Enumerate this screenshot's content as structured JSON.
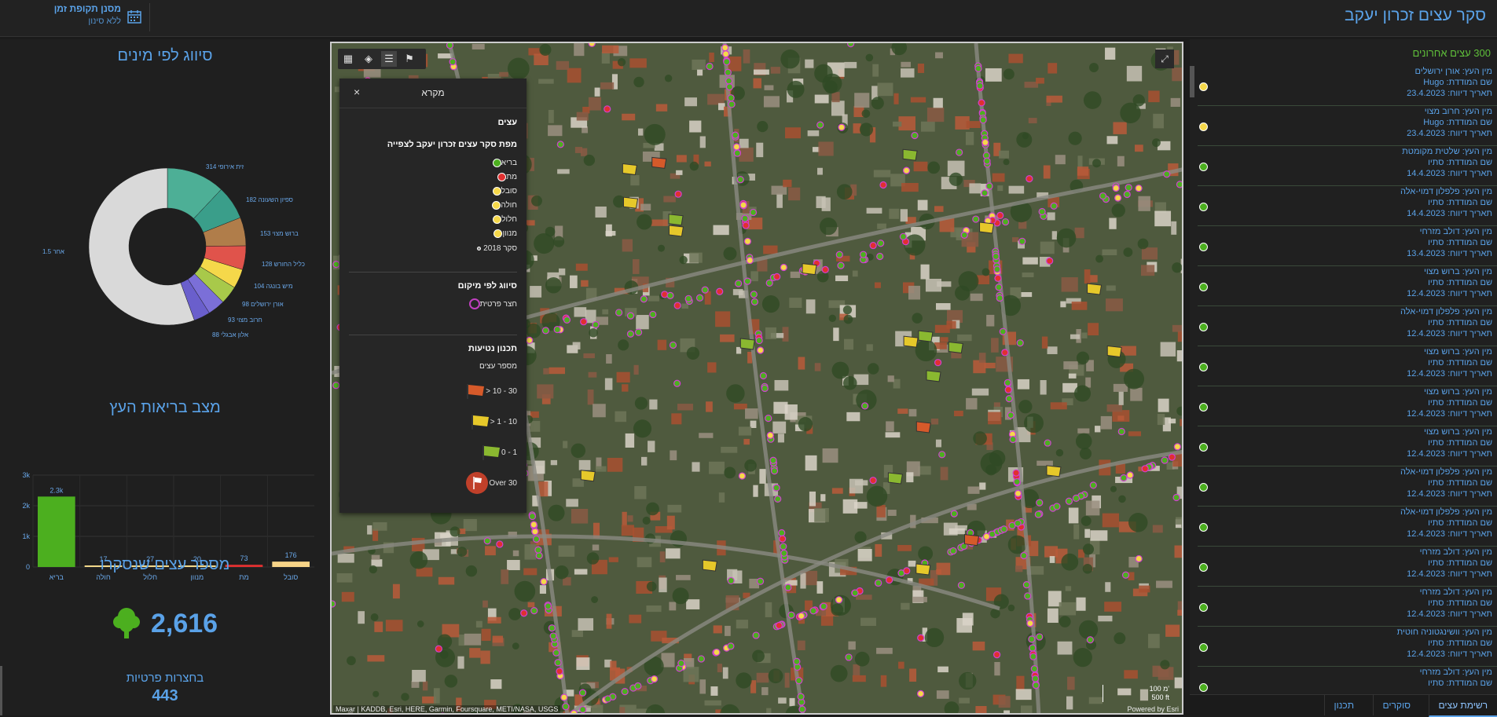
{
  "header": {
    "title": "סקר עצים זכרון יעקב",
    "filter_title": "מסנן תקופת זמן",
    "filter_subtitle": "ללא סינון"
  },
  "species_panel": {
    "title": "סיווג לפי מינים",
    "labels": [
      {
        "name": "זית אירופי",
        "value": "314"
      },
      {
        "name": "ספיון השעונה",
        "value": "182"
      },
      {
        "name": "ברוש מצוי",
        "value": "153"
      },
      {
        "name": "כליל החורש",
        "value": "128"
      },
      {
        "name": "מיש בונגה",
        "value": "104"
      },
      {
        "name": "אורן ירושלים",
        "value": "98"
      },
      {
        "name": "חרוב מצוי",
        "value": "93"
      },
      {
        "name": "אלון אבגלי",
        "value": "88"
      },
      {
        "name": "אחר",
        "value": "1.5"
      }
    ]
  },
  "health_panel": {
    "title": "מצב בריאות העץ"
  },
  "count_panel": {
    "title": "מספר עצים שנסקרו",
    "value": "2,616",
    "private_label": "בחצרות פרטיות",
    "private_value": "443"
  },
  "chart_data": [
    {
      "type": "pie",
      "title": "סיווג לפי מינים",
      "categories": [
        "זית אירופי",
        "ספיון השעונה",
        "ברוש מצוי",
        "כליל החורש",
        "מיש בונגה",
        "אורן ירושלים",
        "חרוב מצוי",
        "אלון אבגלי",
        "אחר"
      ],
      "values": [
        314,
        182,
        153,
        128,
        104,
        98,
        93,
        88,
        1452
      ],
      "colors": [
        "#4daf96",
        "#3a9e8a",
        "#b07d4a",
        "#e0534b",
        "#f5d84a",
        "#a8c94a",
        "#7b6fd8",
        "#6a5fcc",
        "#d9d9d9"
      ]
    },
    {
      "type": "bar",
      "title": "מצב בריאות העץ",
      "categories": [
        "בריא",
        "חולה",
        "חלול",
        "מנוון",
        "מת",
        "סובל"
      ],
      "values": [
        2300,
        17,
        27,
        20,
        73,
        176
      ],
      "data_labels": [
        "2.3k",
        "17",
        "27",
        "20",
        "73",
        "176"
      ],
      "colors": [
        "#4caf1f",
        "#f2d88a",
        "#f2d88a",
        "#f2d88a",
        "#e03030",
        "#f7d488"
      ],
      "ylim": [
        0,
        3000
      ],
      "yticks": [
        "0",
        "1k",
        "2k",
        "3k"
      ]
    }
  ],
  "legend": {
    "title": "מקרא",
    "section1": "עצים",
    "layer_title": "מפת סקר עצים זכרון יעקב לצפייה",
    "items": [
      {
        "label": "בריא",
        "color": "#4caf1f"
      },
      {
        "label": "מת",
        "color": "#e03030"
      },
      {
        "label": "סובל",
        "color": "#f5d84a"
      },
      {
        "label": "חולה",
        "color": "#f5d84a"
      },
      {
        "label": "חלול",
        "color": "#f5d84a"
      },
      {
        "label": "מנוון",
        "color": "#f5d84a"
      }
    ],
    "survey_2018": "סקר 2018",
    "location_title": "סיווג לפי מיקום",
    "private_yard": "חצר פרטית",
    "planting_title": "תכנון נטיעות",
    "planting_sub": "מספר עצים",
    "flags": [
      {
        "label": "30 - 10 <",
        "color": "#d65a2a"
      },
      {
        "label": "10 - 1 <",
        "color": "#e6c82a"
      },
      {
        "label": "1 - 0",
        "color": "#8ab830"
      },
      {
        "label": "Over 30",
        "color": "#c0402a"
      }
    ]
  },
  "map": {
    "attribution": "Maxar | KADDB, Esri, HERE, Garmin, Foursquare, METI/NASA, USGS",
    "powered": "Powered by Esri",
    "scale_metric": "100 מ'",
    "scale_imperial": "500 ft"
  },
  "recent": {
    "title": "300 עצים אחרונים",
    "items": [
      {
        "species": "מין העץ: אורן ירושלים",
        "surveyor": "שם המודדת: Hugo",
        "date": "תאריך דיווח: 23.4.2023",
        "dot": "#f5d84a"
      },
      {
        "species": "מין העץ: חרוב מצוי",
        "surveyor": "שם המודדת: Hugo",
        "date": "תאריך דיווח: 23.4.2023",
        "dot": "#f5d84a"
      },
      {
        "species": "מין העץ: שלטית מקומטת",
        "surveyor": "שם המודדת: סתיו",
        "date": "תאריך דיווח: 14.4.2023",
        "dot": "#4caf1f"
      },
      {
        "species": "מין העץ: פלפלון דמוי-אלה",
        "surveyor": "שם המודדת: סתיו",
        "date": "תאריך דיווח: 14.4.2023",
        "dot": "#4caf1f"
      },
      {
        "species": "מין העץ: דולב מזרחי",
        "surveyor": "שם המודדת: סתיו",
        "date": "תאריך דיווח: 13.4.2023",
        "dot": "#4caf1f"
      },
      {
        "species": "מין העץ: ברוש מצוי",
        "surveyor": "שם המודדת: סתיו",
        "date": "תאריך דיווח: 12.4.2023",
        "dot": "#4caf1f"
      },
      {
        "species": "מין העץ: פלפלון דמוי-אלה",
        "surveyor": "שם המודדת: סתיו",
        "date": "תאריך דיווח: 12.4.2023",
        "dot": "#4caf1f"
      },
      {
        "species": "מין העץ: ברוש מצוי",
        "surveyor": "שם המודדת: סתיו",
        "date": "תאריך דיווח: 12.4.2023",
        "dot": "#4caf1f"
      },
      {
        "species": "מין העץ: ברוש מצוי",
        "surveyor": "שם המודדת: סתיו",
        "date": "תאריך דיווח: 12.4.2023",
        "dot": "#4caf1f"
      },
      {
        "species": "מין העץ: ברוש מצוי",
        "surveyor": "שם המודדת: סתיו",
        "date": "תאריך דיווח: 12.4.2023",
        "dot": "#4caf1f"
      },
      {
        "species": "מין העץ: פלפלון דמוי-אלה",
        "surveyor": "שם המודדת: סתיו",
        "date": "תאריך דיווח: 12.4.2023",
        "dot": "#4caf1f"
      },
      {
        "species": "מין העץ: פלפלון דמוי-אלה",
        "surveyor": "שם המודדת: סתיו",
        "date": "תאריך דיווח: 12.4.2023",
        "dot": "#4caf1f"
      },
      {
        "species": "מין העץ: דולב מזרחי",
        "surveyor": "שם המודדת: סתיו",
        "date": "תאריך דיווח: 12.4.2023",
        "dot": "#4caf1f"
      },
      {
        "species": "מין העץ: דולב מזרחי",
        "surveyor": "שם המודדת: סתיו",
        "date": "תאריך דיווח: 12.4.2023",
        "dot": "#4caf1f"
      },
      {
        "species": "מין העץ: וושינגטוניה חוטית",
        "surveyor": "שם המודדת: סתיו",
        "date": "תאריך דיווח: 12.4.2023",
        "dot": "#4caf1f"
      },
      {
        "species": "מין העץ: דולב מזרחי",
        "surveyor": "שם המודדת: סתיו",
        "date": "",
        "dot": "#4caf1f"
      }
    ],
    "tabs": [
      "רשימת עצים",
      "סוקרים",
      "תכנון"
    ]
  }
}
